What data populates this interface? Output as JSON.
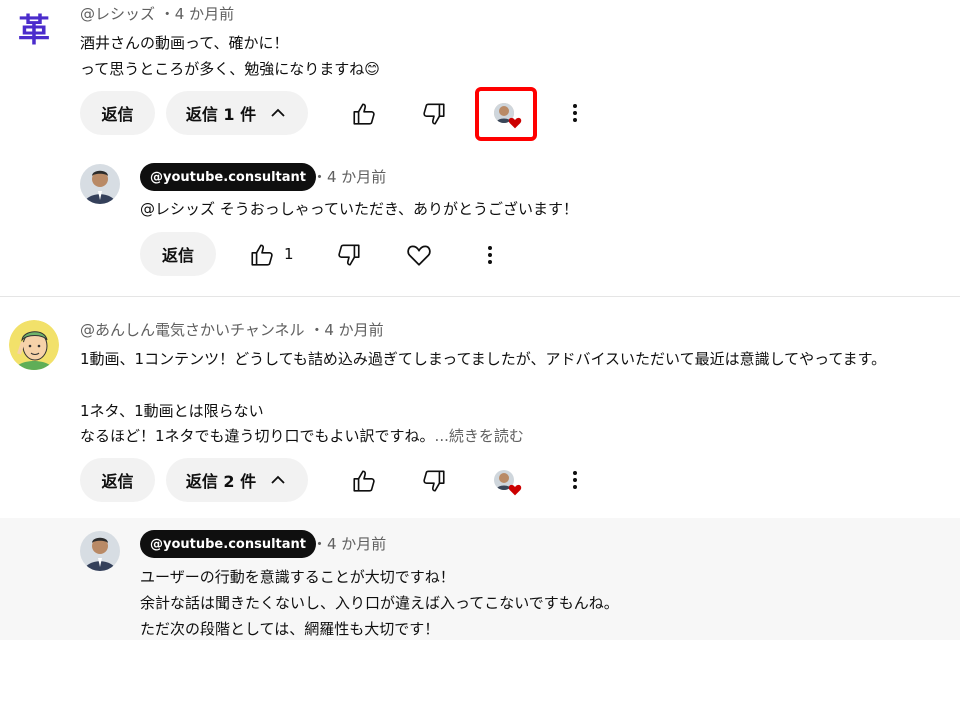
{
  "comment1": {
    "avatar_char": "革",
    "author": "@レシッズ",
    "time": "・4 か月前",
    "text": "酒井さんの動画って、確かに！\nって思うところが多く、勉強になりますね😊",
    "reply_button": "返信",
    "replies_toggle": "返信 1 件",
    "like_count": ""
  },
  "reply1": {
    "author": "@youtube.consultant",
    "time": "・4 か月前",
    "text": "@レシッズ そうおっしゃっていただき、ありがとうございます！",
    "reply_button": "返信",
    "like_count": "1"
  },
  "comment2": {
    "author": "@あんしん電気さかいチャンネル",
    "time": "・4 か月前",
    "text_line1": "1動画、1コンテンツ！どうしても詰め込み過ぎてしまってましたが、アドバイスいただいて最近は意識してやってます。",
    "text_line2": "1ネタ、1動画とは限らない",
    "text_line3": "なるほど！1ネタでも違う切り口でもよい訳ですね。",
    "read_more": "...続きを読む",
    "reply_button": "返信",
    "replies_toggle": "返信 2 件"
  },
  "reply2": {
    "author": "@youtube.consultant",
    "time": "・4 か月前",
    "text": "ユーザーの行動を意識することが大切ですね！\n余計な話は聞きたくないし、入り口が違えば入ってこないですもんね。\nただ次の段階としては、網羅性も大切です！"
  },
  "colors": {
    "highlight": "#ff0000",
    "heart": "#cc0000",
    "chip_bg": "#0f0f0f",
    "avatar_char": "#4b2ccc"
  }
}
